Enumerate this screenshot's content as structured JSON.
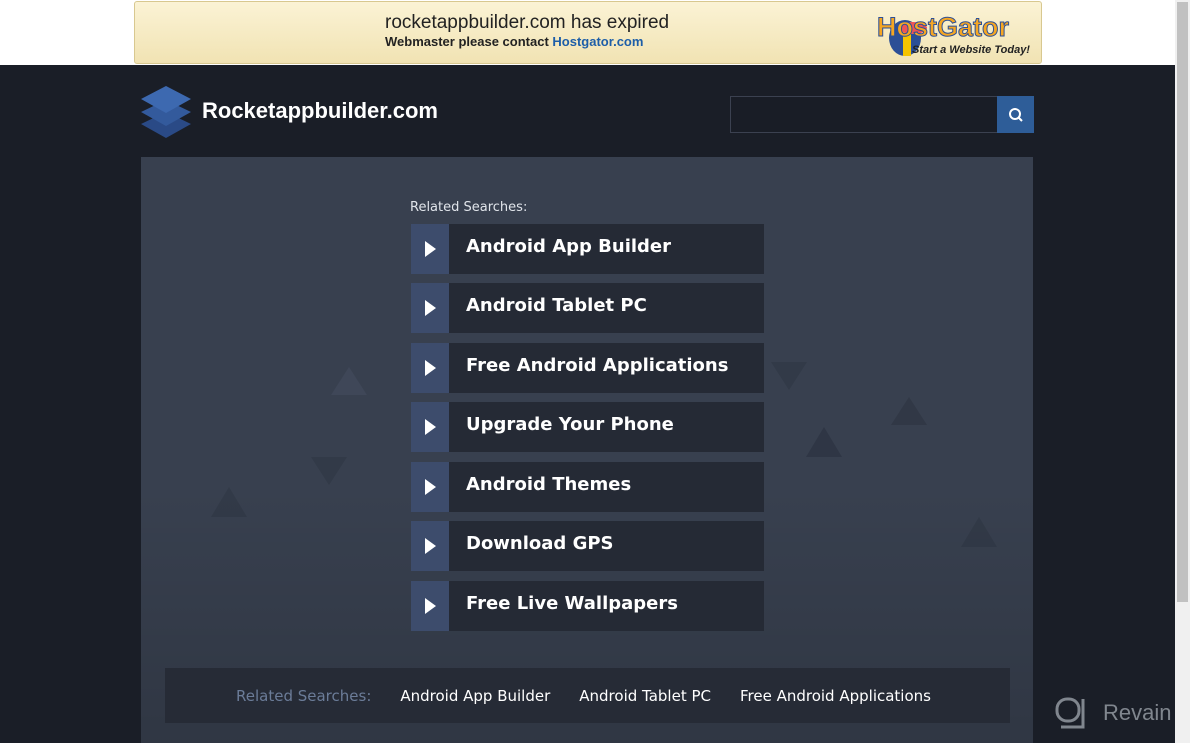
{
  "banner": {
    "title": "rocketappbuilder.com has expired",
    "contact_prefix": "Webmaster please contact",
    "contact_link": "Hostgator.com",
    "brand": "HostGator",
    "tagline": "Start a Website Today!"
  },
  "header": {
    "site_name": "Rocketappbuilder.com",
    "search_placeholder": ""
  },
  "main": {
    "related_label": "Related Searches:",
    "items": [
      {
        "label": "Android App Builder"
      },
      {
        "label": "Android Tablet PC"
      },
      {
        "label": "Free Android Applications"
      },
      {
        "label": "Upgrade Your Phone"
      },
      {
        "label": "Android Themes"
      },
      {
        "label": "Download GPS"
      },
      {
        "label": "Free Live Wallpapers"
      }
    ]
  },
  "footer": {
    "related_label": "Related Searches:",
    "links": [
      "Android App Builder",
      "Android Tablet PC",
      "Free Android Applications"
    ]
  },
  "watermark": "Revain",
  "colors": {
    "accent": "#2e5d98",
    "background": "#1a1e27",
    "panel": "#38404f"
  }
}
